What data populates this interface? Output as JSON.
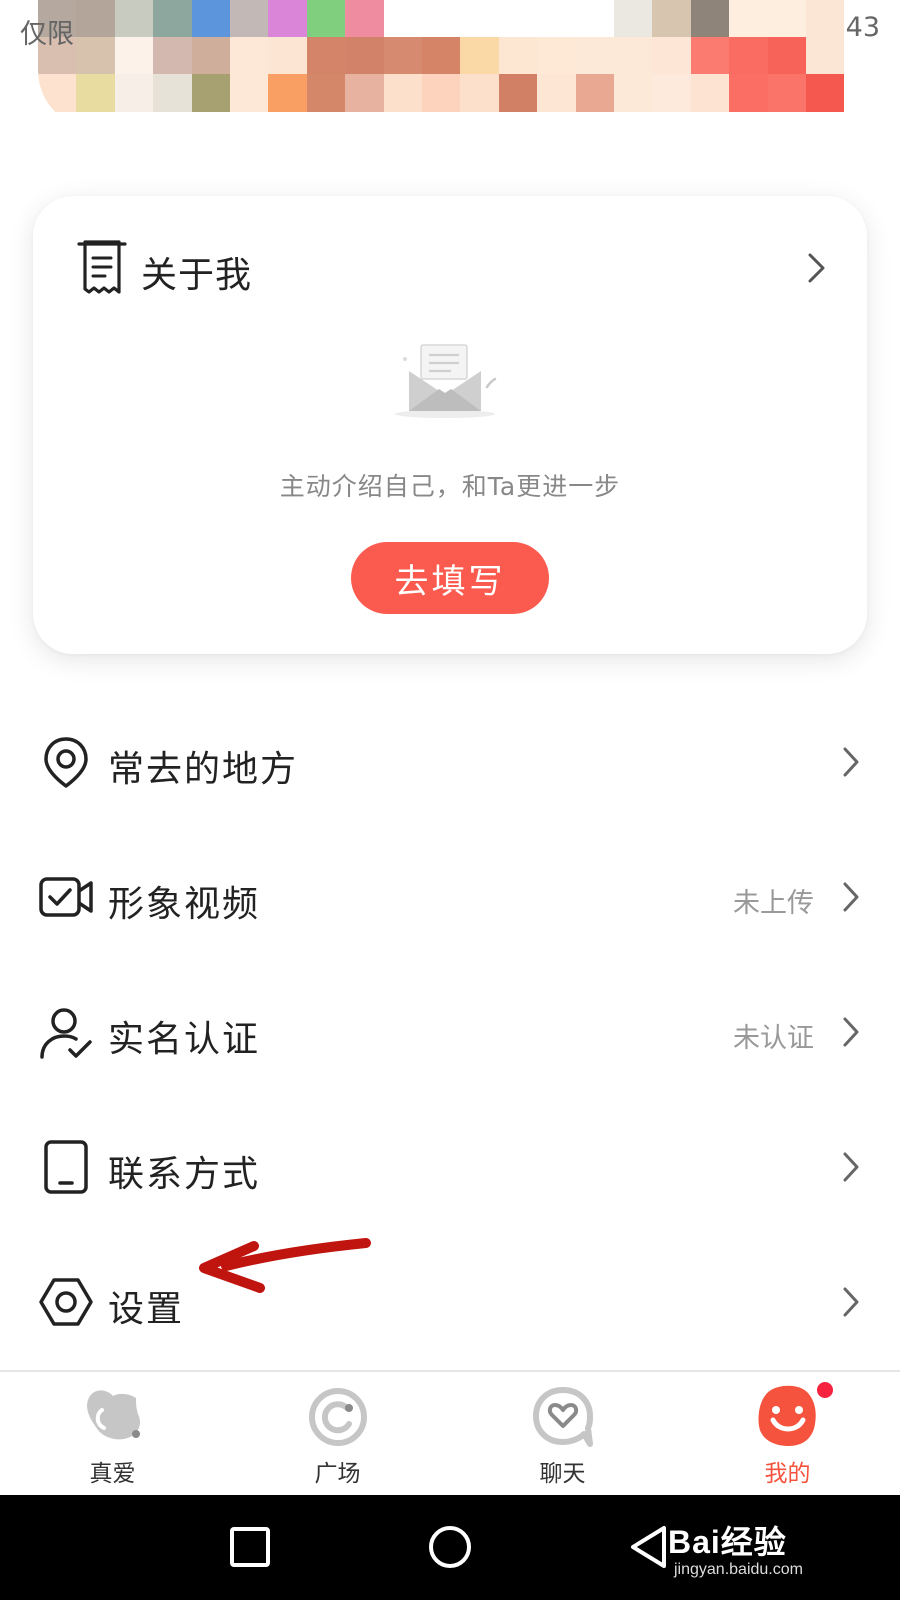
{
  "status_bar": {
    "left_text": "仅限",
    "right_text": "43"
  },
  "about": {
    "title": "关于我",
    "hint": "主动介绍自己，和Ta更进一步",
    "fill_button": "去填写"
  },
  "menu": [
    {
      "label": "常去的地方",
      "status": "",
      "icon": "location-pin-icon"
    },
    {
      "label": "形象视频",
      "status": "未上传",
      "icon": "video-check-icon"
    },
    {
      "label": "实名认证",
      "status": "未认证",
      "icon": "user-verified-icon"
    },
    {
      "label": "联系方式",
      "status": "",
      "icon": "phone-icon"
    },
    {
      "label": "设置",
      "status": "",
      "icon": "settings-hexagon-icon"
    }
  ],
  "tabs": [
    {
      "label": "真爱",
      "icon": "heart-bubble-icon",
      "active": false
    },
    {
      "label": "广场",
      "icon": "plaza-circle-icon",
      "active": false
    },
    {
      "label": "聊天",
      "icon": "chat-heart-icon",
      "active": false
    },
    {
      "label": "我的",
      "icon": "smiley-profile-icon",
      "active": true,
      "badge": true
    }
  ],
  "watermark": {
    "main": "Bai经验",
    "sub": "jingyan.baidu.com"
  },
  "colors": {
    "accent": "#fb5a4e",
    "active_tab": "#f5533d",
    "badge": "#f7233e",
    "annotation_arrow": "#c0140f"
  }
}
